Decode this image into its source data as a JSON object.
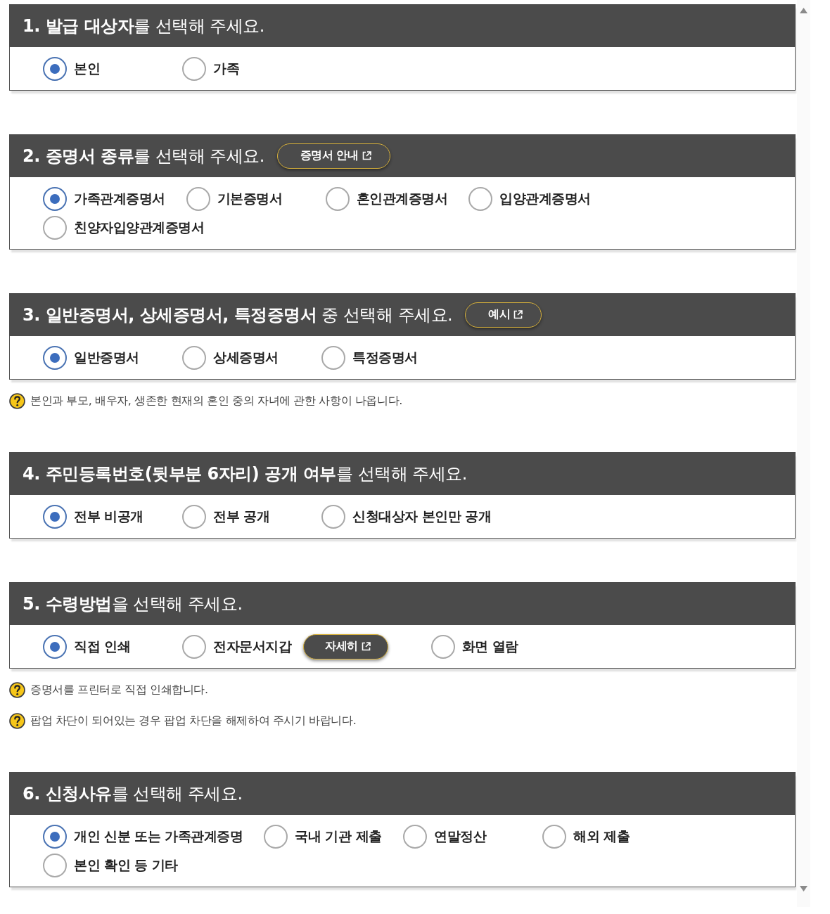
{
  "sections": [
    {
      "title": "**1. 발급 대상자**를 선택해 주세요.",
      "options": [
        {
          "label": "본인",
          "selected": true
        },
        {
          "label": "가족",
          "selected": false
        }
      ]
    },
    {
      "title": "**2. 증명서 종류**를 선택해 주세요.",
      "button": "증명서 안내",
      "options": [
        {
          "label": "가족관계증명서",
          "selected": true
        },
        {
          "label": "기본증명서",
          "selected": false
        },
        {
          "label": "혼인관계증명서",
          "selected": false
        },
        {
          "label": "입양관계증명서",
          "selected": false
        },
        {
          "label": "친양자입양관계증명서",
          "selected": false
        }
      ]
    },
    {
      "title": "**3. 일반증명서, 상세증명서, 특정증명서** 중 선택해 주세요.",
      "button": "예시",
      "options": [
        {
          "label": "일반증명서",
          "selected": true
        },
        {
          "label": "상세증명서",
          "selected": false
        },
        {
          "label": "특정증명서",
          "selected": false
        }
      ],
      "notes": [
        "본인과 부모, 배우자, 생존한 현재의 혼인 중의 자녀에 관한 사항이 나옵니다."
      ]
    },
    {
      "title": "**4. 주민등록번호(뒷부분 6자리) 공개 여부**를 선택해 주세요.",
      "options": [
        {
          "label": "전부 비공개",
          "selected": true
        },
        {
          "label": "전부 공개",
          "selected": false
        },
        {
          "label": "신청대상자 본인만 공개",
          "selected": false
        }
      ]
    },
    {
      "title": "**5. 수령방법**을 선택해 주세요.",
      "options": [
        {
          "label": "직접 인쇄",
          "selected": true
        },
        {
          "label": "전자문서지갑",
          "selected": false,
          "button": "자세히"
        },
        {
          "label": "화면 열람",
          "selected": false
        }
      ],
      "notes": [
        "증명서를 프린터로 직접 인쇄합니다.",
        "팝업 차단이 되어있는 경우 팝업 차단을 해제하여 주시기 바랍니다."
      ]
    },
    {
      "title": "**6. 신청사유**를 선택해 주세요.",
      "options": [
        {
          "label": "개인 신분 또는 가족관계증명",
          "selected": true
        },
        {
          "label": "국내 기관 제출",
          "selected": false
        },
        {
          "label": "연말정산",
          "selected": false
        },
        {
          "label": "해외 제출",
          "selected": false
        },
        {
          "label": "본인 확인 등 기타",
          "selected": false
        }
      ]
    }
  ]
}
